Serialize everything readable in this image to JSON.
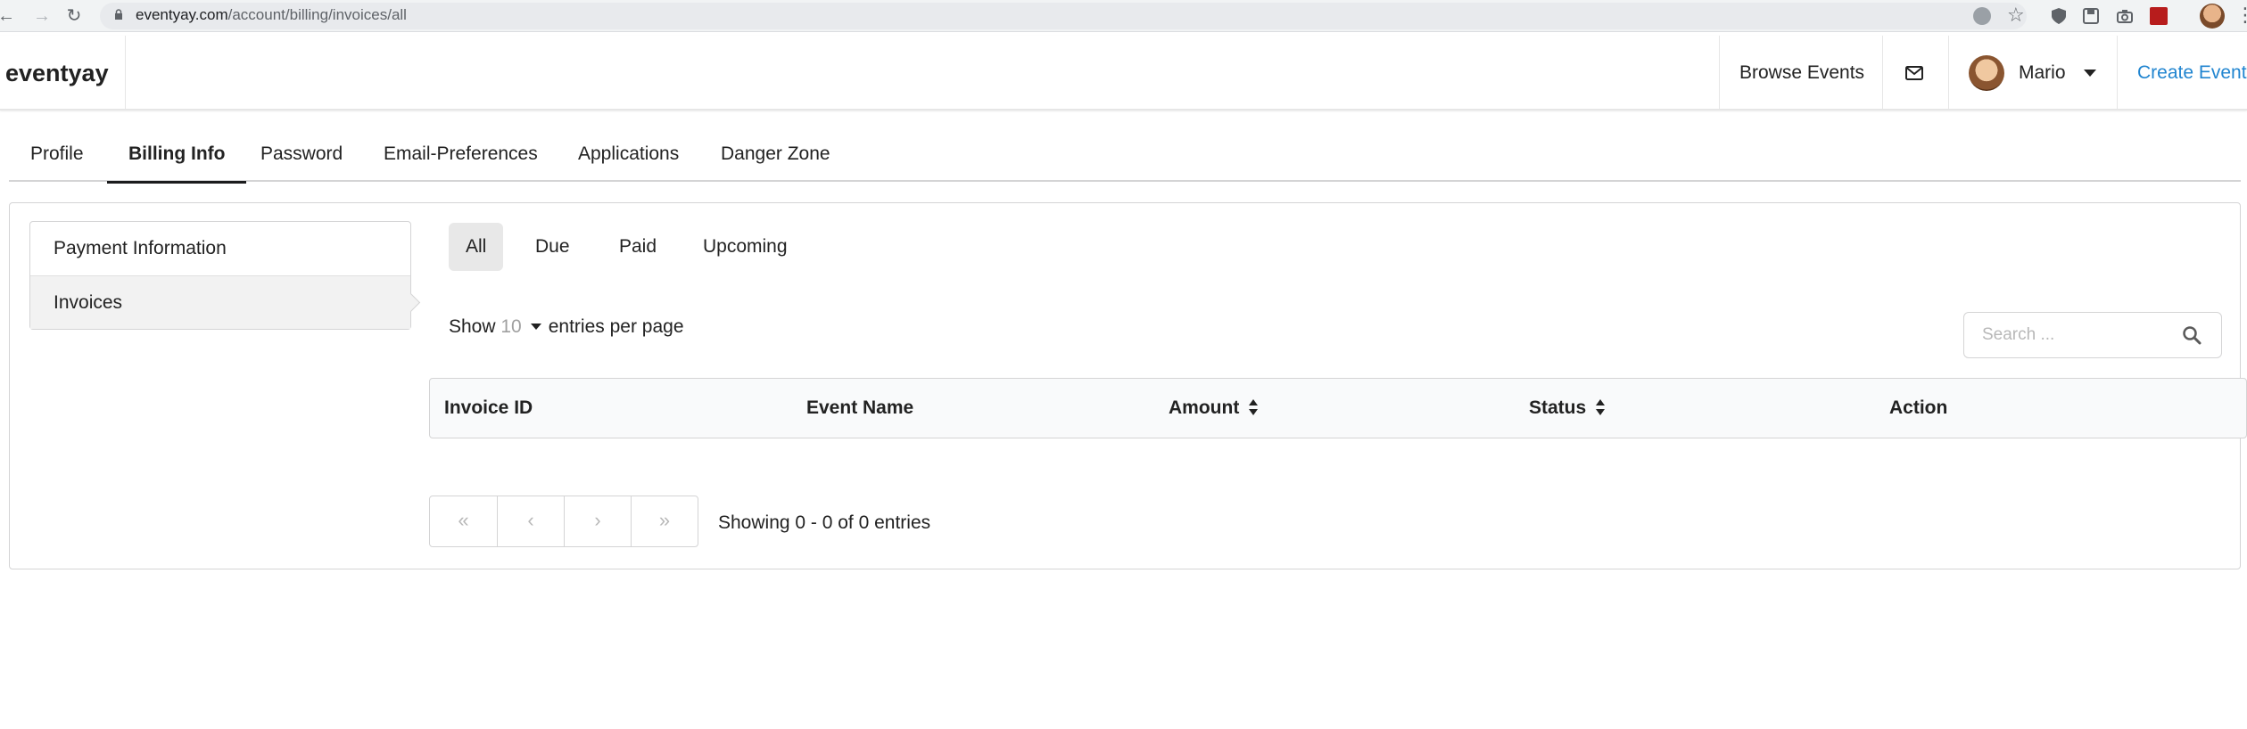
{
  "browser": {
    "url_domain": "eventyay.com",
    "url_path": "/account/billing/invoices/all"
  },
  "header": {
    "brand": "eventyay",
    "browse_events": "Browse Events",
    "user_name": "Mario",
    "create_event": "Create Event"
  },
  "tabs": [
    {
      "label": "Profile",
      "active": false
    },
    {
      "label": "Billing Info",
      "active": true
    },
    {
      "label": "Password",
      "active": false
    },
    {
      "label": "Email-Preferences",
      "active": false
    },
    {
      "label": "Applications",
      "active": false
    },
    {
      "label": "Danger Zone",
      "active": false
    }
  ],
  "side_menu": [
    {
      "label": "Payment Information",
      "active": false
    },
    {
      "label": "Invoices",
      "active": true
    }
  ],
  "filters": [
    {
      "label": "All",
      "active": true
    },
    {
      "label": "Due",
      "active": false
    },
    {
      "label": "Paid",
      "active": false
    },
    {
      "label": "Upcoming",
      "active": false
    }
  ],
  "entries": {
    "show_label": "Show",
    "per_page": "10",
    "suffix": "entries per page"
  },
  "search": {
    "placeholder": "Search ..."
  },
  "table": {
    "columns": [
      {
        "label": "Invoice ID",
        "sortable": false
      },
      {
        "label": "Event Name",
        "sortable": false
      },
      {
        "label": "Amount",
        "sortable": true
      },
      {
        "label": "Status",
        "sortable": true
      },
      {
        "label": "Action",
        "sortable": false
      }
    ],
    "rows": []
  },
  "pagination": {
    "first": "«",
    "prev": "‹",
    "next": "›",
    "last": "»",
    "info": "Showing 0 - 0 of 0 entries"
  },
  "colors": {
    "accent": "#2185d0",
    "active_bg": "#e8e8e8"
  }
}
